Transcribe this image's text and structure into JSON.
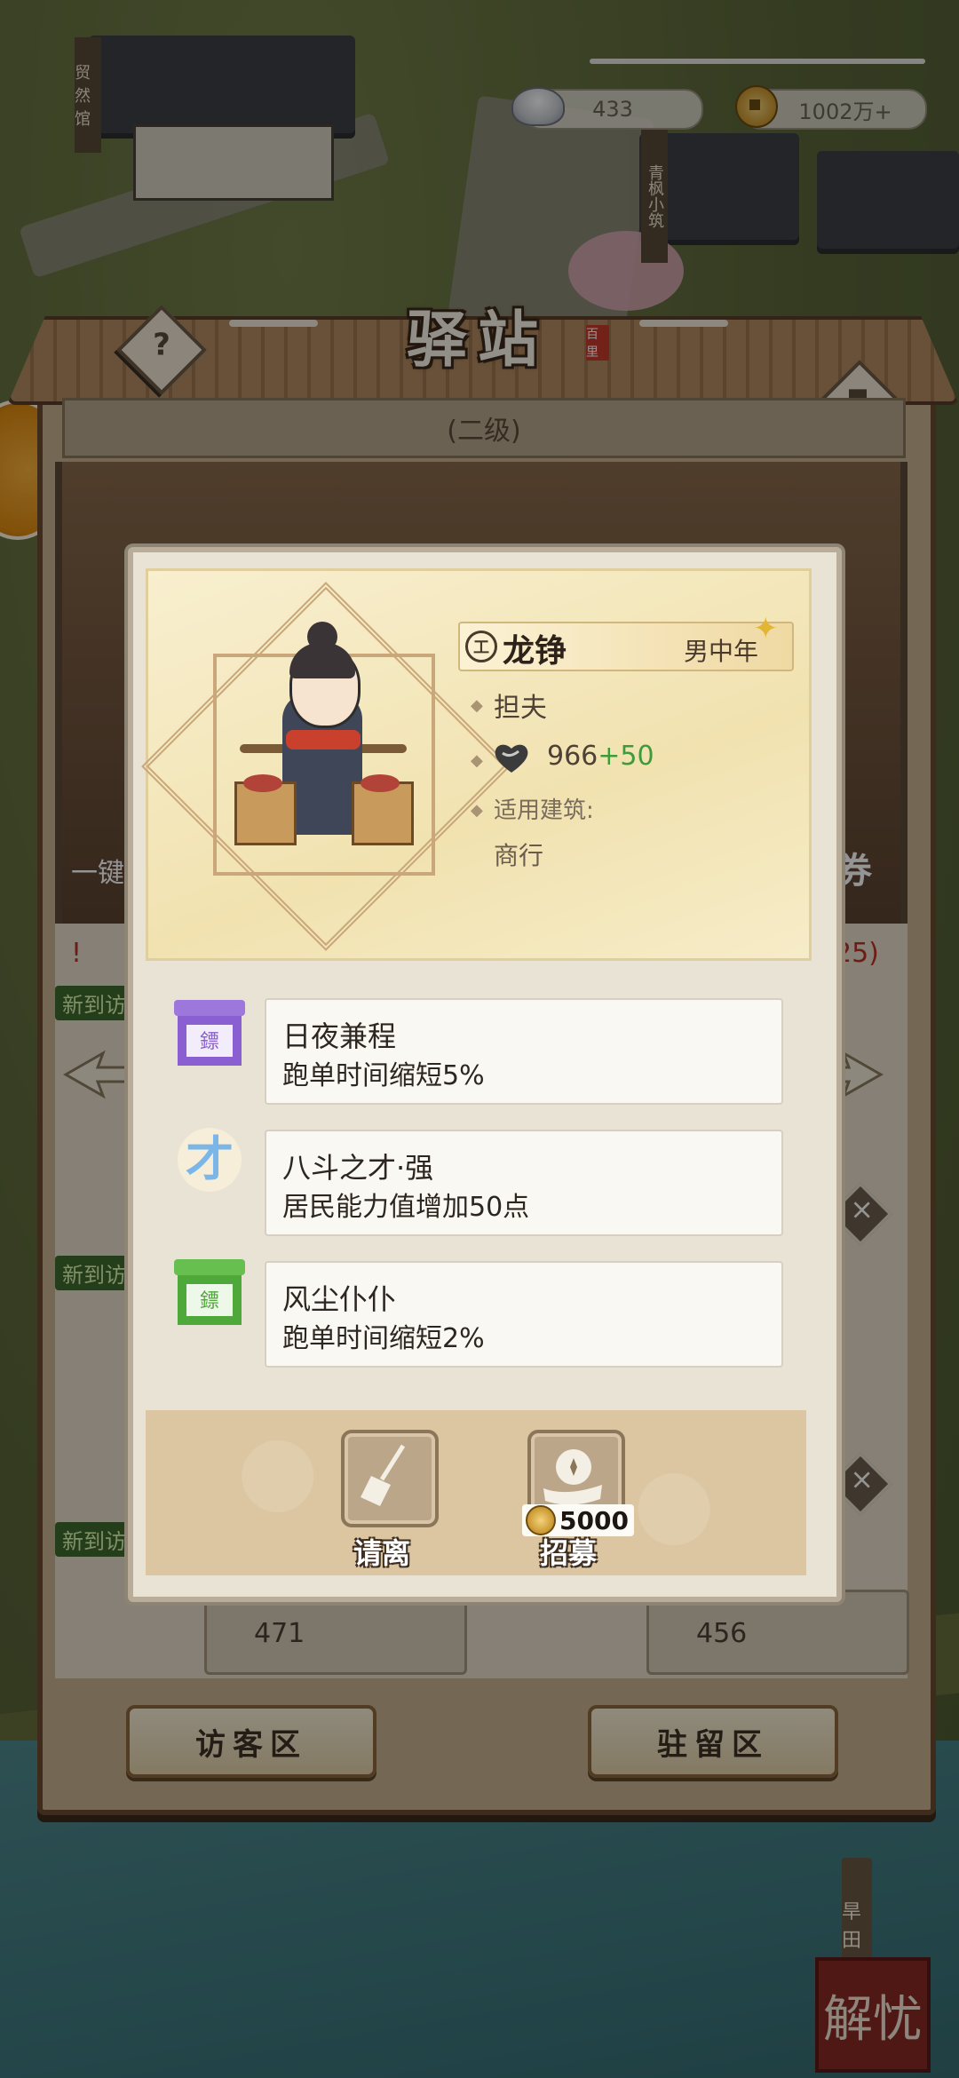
{
  "hud": {
    "silver_value": "433",
    "coin_value": "1002万+"
  },
  "panel": {
    "title": "驿站",
    "title_seal": "百里",
    "level": "(二级)",
    "help_glyph": "?",
    "left_zone_button": "访客区",
    "right_zone_button": "驻留区",
    "under_values": [
      "471",
      "456"
    ],
    "under_tags": [
      "新到访",
      "新到访",
      "新到访"
    ],
    "under_side_left": "一键",
    "under_side_right": "券",
    "warn_count": "25)"
  },
  "character": {
    "name": "龙铮",
    "badge": "工",
    "gender_age": "男中年",
    "profession": "担夫",
    "ability_base": "966",
    "ability_bonus": "+50",
    "building_label": "适用建筑:",
    "building_value": "商行"
  },
  "skills": [
    {
      "icon": "purple-escort-banner-icon",
      "name": "日夜兼程",
      "desc": "跑单时间缩短5%",
      "icon_text": "鏢",
      "color": "#8a5fd1"
    },
    {
      "icon": "talent-brush-icon",
      "name": "八斗之才·强",
      "desc": "居民能力值增加50点",
      "icon_text": "才",
      "color": "#7ab6e8"
    },
    {
      "icon": "green-escort-banner-icon",
      "name": "风尘仆仆",
      "desc": "跑单时间缩短2%",
      "icon_text": "鏢",
      "color": "#4fa83a"
    }
  ],
  "actions": {
    "dismiss_label": "请离",
    "recruit_label": "招募",
    "recruit_cost": "5000"
  },
  "map_labels": {
    "building_left": "贸然馆",
    "building_right": "青枫小筑",
    "field": "旱田",
    "jieyou": "解忧"
  }
}
